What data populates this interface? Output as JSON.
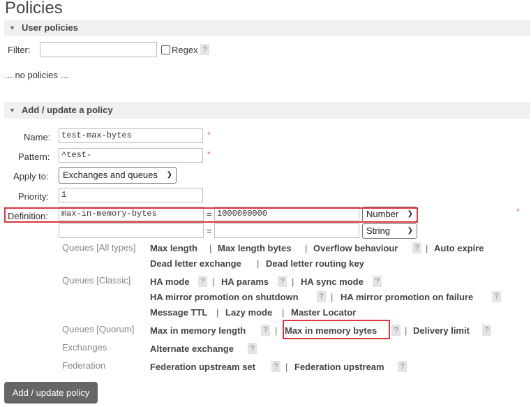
{
  "title": "Policies",
  "user_policies": {
    "header": "User policies",
    "filter_label": "Filter:",
    "filter_value": "",
    "regex_label": "Regex",
    "help": "?",
    "empty_text": "... no policies ..."
  },
  "add_policy": {
    "header": "Add / update a policy",
    "name_label": "Name:",
    "name_value": "test-max-bytes",
    "pattern_label": "Pattern:",
    "pattern_value": "^test-",
    "apply_label": "Apply to:",
    "apply_value": "Exchanges and queues",
    "priority_label": "Priority:",
    "priority_value": "1",
    "definition_label": "Definition:",
    "required_mark": "*",
    "eq": "=",
    "def_rows": [
      {
        "key": "max-in-memory-bytes",
        "value": "1000000000",
        "type": "Number"
      },
      {
        "key": "",
        "value": "",
        "type": "String"
      }
    ],
    "categories": {
      "queues_all": "Queues [All types]",
      "queues_classic": "Queues [Classic]",
      "queues_quorum": "Queues [Quorum]",
      "exchanges": "Exchanges",
      "federation": "Federation"
    },
    "links": {
      "max_length": "Max length",
      "max_length_bytes": "Max length bytes",
      "overflow_behaviour": "Overflow behaviour",
      "auto_expire": "Auto expire",
      "dead_letter_exchange": "Dead letter exchange",
      "dead_letter_routing_key": "Dead letter routing key",
      "ha_mode": "HA mode",
      "ha_params": "HA params",
      "ha_sync_mode": "HA sync mode",
      "ha_mirror_shutdown": "HA mirror promotion on shutdown",
      "ha_mirror_failure": "HA mirror promotion on failure",
      "message_ttl": "Message TTL",
      "lazy_mode": "Lazy mode",
      "master_locator": "Master Locator",
      "max_in_memory_length": "Max in memory length",
      "max_in_memory_bytes": "Max in memory bytes",
      "delivery_limit": "Delivery limit",
      "alternate_exchange": "Alternate exchange",
      "federation_upstream_set": "Federation upstream set",
      "federation_upstream": "Federation upstream"
    },
    "separator": "|",
    "submit_label": "Add / update policy"
  },
  "colors": {
    "highlight": "#d9383f",
    "button": "#666666",
    "section_bg": "#f0f0f0"
  }
}
